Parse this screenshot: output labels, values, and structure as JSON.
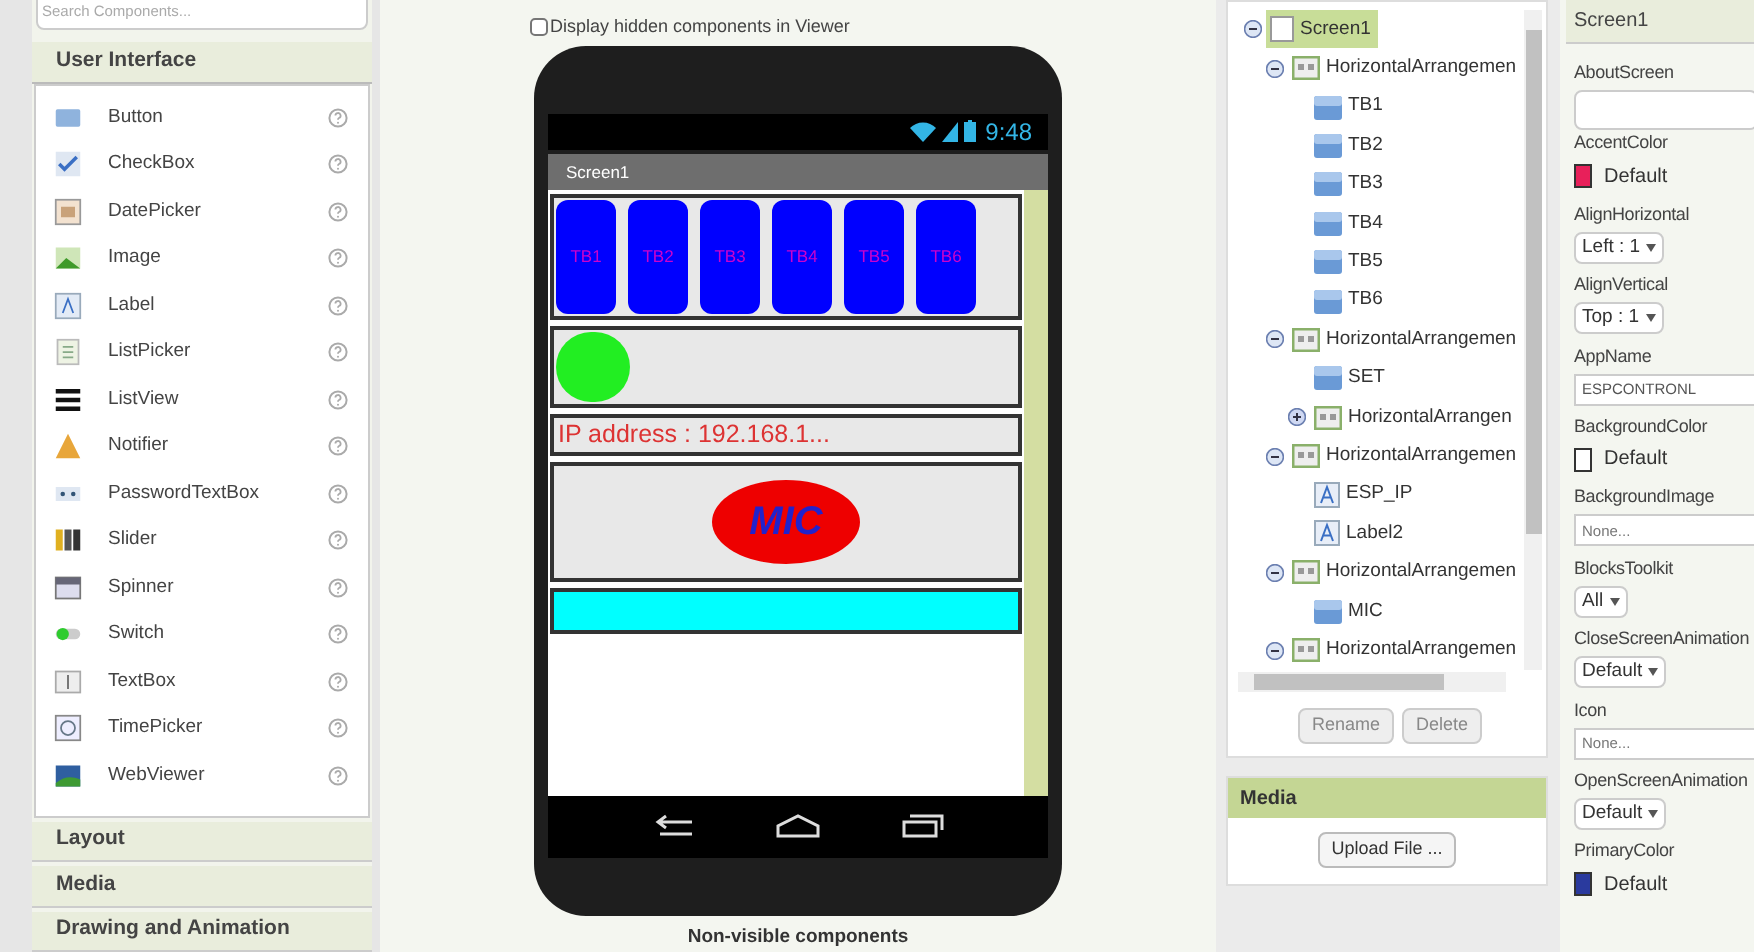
{
  "palette": {
    "search": {
      "placeholder": "Search Components..."
    },
    "open_section": "User Interface",
    "items": [
      {
        "label": "Button",
        "kind": "button"
      },
      {
        "label": "CheckBox",
        "kind": "checkbox"
      },
      {
        "label": "DatePicker",
        "kind": "datepicker"
      },
      {
        "label": "Image",
        "kind": "image"
      },
      {
        "label": "Label",
        "kind": "label"
      },
      {
        "label": "ListPicker",
        "kind": "listpicker"
      },
      {
        "label": "ListView",
        "kind": "listview"
      },
      {
        "label": "Notifier",
        "kind": "notifier"
      },
      {
        "label": "PasswordTextBox",
        "kind": "password"
      },
      {
        "label": "Slider",
        "kind": "slider"
      },
      {
        "label": "Spinner",
        "kind": "spinner"
      },
      {
        "label": "Switch",
        "kind": "switch"
      },
      {
        "label": "TextBox",
        "kind": "textbox"
      },
      {
        "label": "TimePicker",
        "kind": "timepicker"
      },
      {
        "label": "WebViewer",
        "kind": "webviewer"
      }
    ],
    "sections": [
      "Layout",
      "Media",
      "Drawing and Animation"
    ]
  },
  "viewer": {
    "hidden_checkbox": {
      "label": "Display hidden components in Viewer",
      "checked": false
    },
    "phone": {
      "time": "9:48",
      "screen_title": "Screen1",
      "buttons": [
        "TB1",
        "TB2",
        "TB3",
        "TB4",
        "TB5",
        "TB6"
      ],
      "ip_label": "IP address : 192.168.1...",
      "mic_button": "MIC"
    },
    "non_visible": "Non-visible components"
  },
  "components": {
    "tree": [
      {
        "label": "Screen1",
        "kind": "screen",
        "expanded": true,
        "selected": true,
        "children": [
          {
            "label": "HorizontalArrangemen",
            "kind": "arrangement",
            "expanded": true,
            "selected": false,
            "children": [
              {
                "label": "TB1",
                "kind": "button",
                "selected": false
              },
              {
                "label": "TB2",
                "kind": "button",
                "selected": false
              },
              {
                "label": "TB3",
                "kind": "button",
                "selected": false
              },
              {
                "label": "TB4",
                "kind": "button",
                "selected": false
              },
              {
                "label": "TB5",
                "kind": "button",
                "selected": false
              },
              {
                "label": "TB6",
                "kind": "button",
                "selected": false
              }
            ]
          },
          {
            "label": "HorizontalArrangemen",
            "kind": "arrangement",
            "expanded": true,
            "selected": false,
            "children": [
              {
                "label": "SET",
                "kind": "button",
                "selected": false
              },
              {
                "label": "HorizontalArrangen",
                "kind": "arrangement",
                "expanded": false,
                "selected": false
              }
            ]
          },
          {
            "label": "HorizontalArrangemen",
            "kind": "arrangement",
            "expanded": true,
            "selected": false,
            "children": [
              {
                "label": "ESP_IP",
                "kind": "label",
                "selected": false
              },
              {
                "label": "Label2",
                "kind": "label",
                "selected": false
              }
            ]
          },
          {
            "label": "HorizontalArrangemen",
            "kind": "arrangement",
            "expanded": true,
            "selected": false,
            "children": [
              {
                "label": "MIC",
                "kind": "button",
                "selected": false
              }
            ]
          },
          {
            "label": "HorizontalArrangemen",
            "kind": "arrangement",
            "expanded": true,
            "selected": false
          }
        ]
      }
    ],
    "buttons": [
      "Rename",
      "Delete"
    ]
  },
  "media": {
    "title": "Media",
    "upload_button": "Upload File ..."
  },
  "properties": {
    "title": "Screen1",
    "items": [
      {
        "name": "AboutScreen",
        "kind": "textarea"
      },
      {
        "name": "AccentColor",
        "kind": "color",
        "value": "Default",
        "color": "#e8205a"
      },
      {
        "name": "AlignHorizontal",
        "kind": "dropdown",
        "value": "Left : 1"
      },
      {
        "name": "AlignVertical",
        "kind": "dropdown",
        "value": "Top : 1"
      },
      {
        "name": "AppName",
        "kind": "text",
        "value": "ESPCONTRONL"
      },
      {
        "name": "BackgroundColor",
        "kind": "color",
        "value": "Default",
        "color": "#ffffff"
      },
      {
        "name": "BackgroundImage",
        "kind": "asset",
        "value": "None..."
      },
      {
        "name": "BlocksToolkit",
        "kind": "dropdown",
        "value": "All"
      },
      {
        "name": "CloseScreenAnimation",
        "kind": "dropdown",
        "value": "Default"
      },
      {
        "name": "Icon",
        "kind": "asset",
        "value": "None..."
      },
      {
        "name": "OpenScreenAnimation",
        "kind": "dropdown",
        "value": "Default"
      },
      {
        "name": "PrimaryColor",
        "kind": "color",
        "value": "Default",
        "color": "#2a3a9e"
      }
    ]
  }
}
